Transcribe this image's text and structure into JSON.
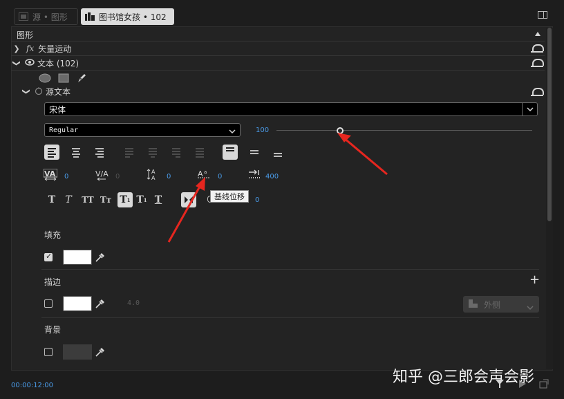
{
  "tabs": [
    {
      "label": "源 • 图形",
      "active": false
    },
    {
      "label": "图书馆女孩 • 102",
      "active": true
    }
  ],
  "panel": {
    "title": "图形",
    "sections": {
      "vector_motion": "矢量运动",
      "text_layer": "文本 (102)",
      "source_text": "源文本"
    },
    "font_family": "宋体",
    "font_style": "Regular",
    "font_size": "100",
    "metrics": {
      "kerning": "0",
      "tracking": "0",
      "leading": "0",
      "baseline_shift": "0",
      "tsume": "0",
      "tab_width": "400"
    },
    "tooltip": "基线位移",
    "fill_label": "填充",
    "stroke_label": "描边",
    "stroke_width": "4.0",
    "stroke_position": "外侧",
    "background_label": "背景"
  },
  "timecode": "00:00:12:00",
  "watermark": "知乎 @三郎会声会影",
  "colors": {
    "accent": "#4a9be8",
    "arrow": "#e6261f"
  }
}
